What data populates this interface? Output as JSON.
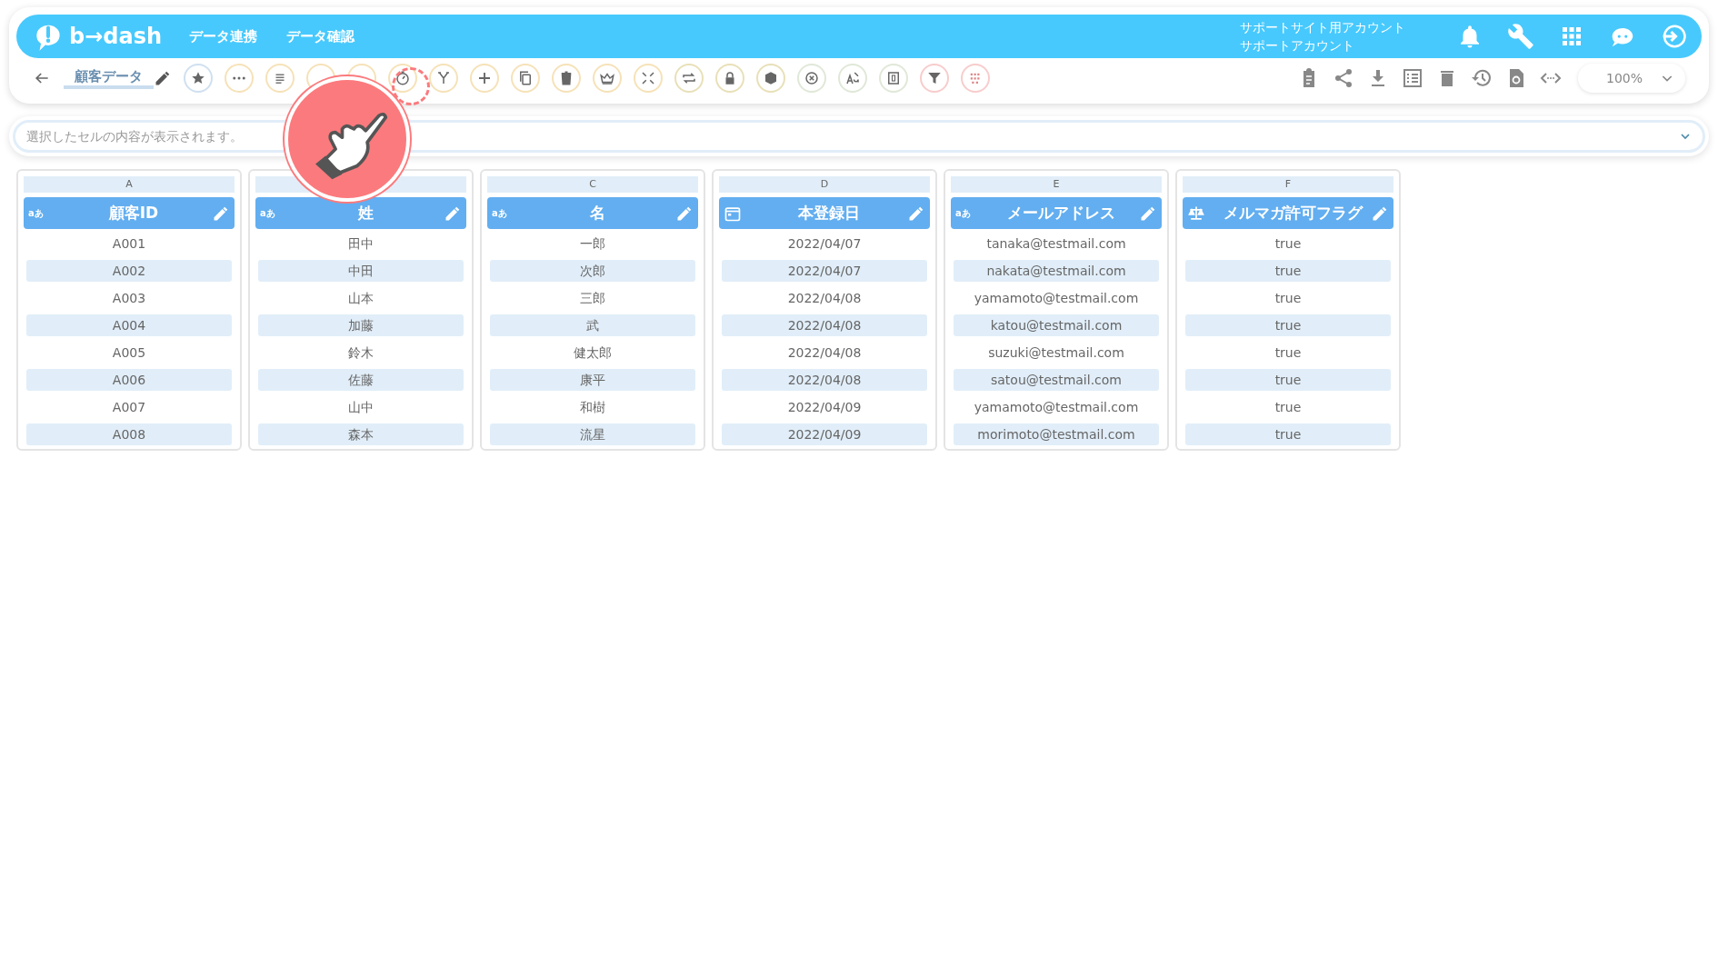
{
  "header": {
    "logo": "b→dash",
    "nav": [
      "データ連携",
      "データ確認"
    ],
    "account": [
      "サポートサイト用アカウント",
      "サポートアカウント"
    ]
  },
  "toolbar": {
    "title": "顧客データ",
    "zoom": "100%"
  },
  "cell_viewer": {
    "placeholder": "選択したセルの内容が表示されます。"
  },
  "columns": [
    {
      "letter": "A",
      "kind": "text",
      "type_label": "aあ",
      "name": "顧客ID",
      "cells": [
        "A001",
        "A002",
        "A003",
        "A004",
        "A005",
        "A006",
        "A007",
        "A008"
      ]
    },
    {
      "kind": "text",
      "type_label": "aあ",
      "name": "姓",
      "cells": [
        "田中",
        "中田",
        "山本",
        "加藤",
        "鈴木",
        "佐藤",
        "山中",
        "森本"
      ]
    },
    {
      "letter": "C",
      "kind": "text",
      "type_label": "aあ",
      "name": "名",
      "cells": [
        "一郎",
        "次郎",
        "三郎",
        "武",
        "健太郎",
        "康平",
        "和樹",
        "流星"
      ]
    },
    {
      "letter": "D",
      "kind": "date",
      "name": "本登録日",
      "cells": [
        "2022/04/07",
        "2022/04/07",
        "2022/04/08",
        "2022/04/08",
        "2022/04/08",
        "2022/04/08",
        "2022/04/09",
        "2022/04/09"
      ]
    },
    {
      "letter": "E",
      "kind": "text",
      "type_label": "aあ",
      "name": "メールアドレス",
      "cells": [
        "tanaka@testmail.com",
        "nakata@testmail.com",
        "yamamoto@testmail.com",
        "katou@testmail.com",
        "suzuki@testmail.com",
        "satou@testmail.com",
        "yamamoto@testmail.com",
        "morimoto@testmail.com"
      ]
    },
    {
      "letter": "F",
      "kind": "boolean",
      "name": "メルマガ許可フラグ",
      "cells": [
        "true",
        "true",
        "true",
        "true",
        "true",
        "true",
        "true",
        "true"
      ]
    }
  ]
}
